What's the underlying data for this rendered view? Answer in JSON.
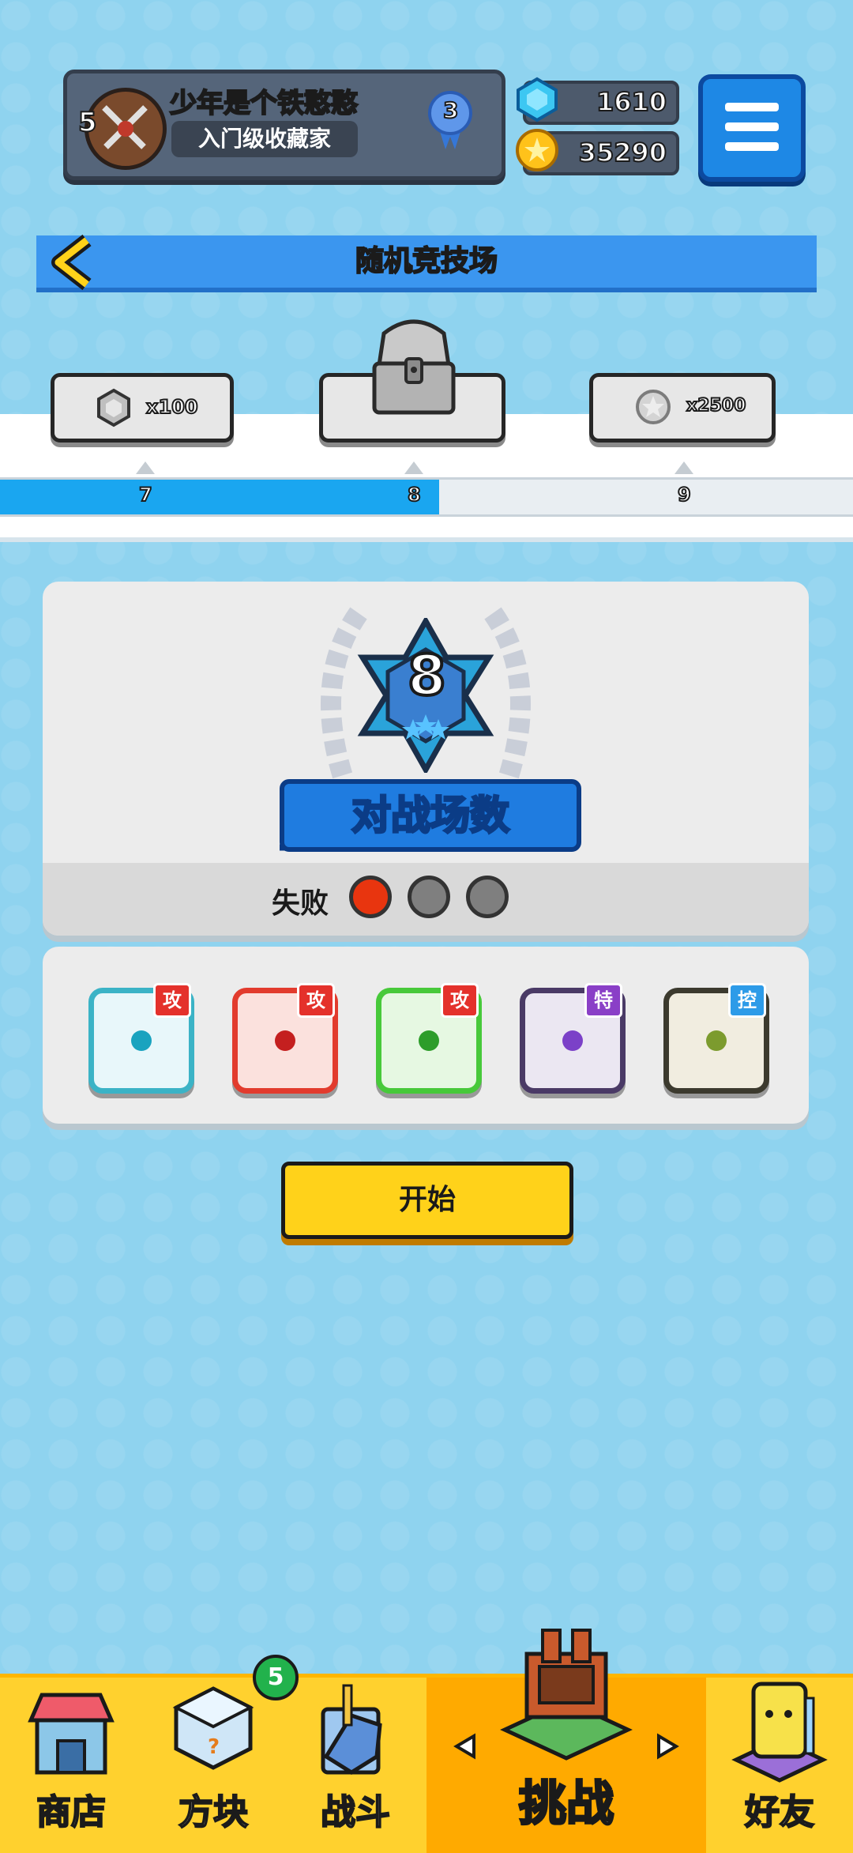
{
  "profile": {
    "name": "少年是个铁憨憨",
    "title": "入门级收藏家",
    "level": "5",
    "rank": "3"
  },
  "currency": {
    "gems": "1610",
    "gold": "35290"
  },
  "arena": {
    "title": "随机竞技场"
  },
  "rewards": {
    "items": [
      {
        "label": "x100",
        "icon": "hex-gem-icon"
      },
      {
        "label": "",
        "icon": "treasure-chest-icon"
      },
      {
        "label": "x2500",
        "icon": "silver-coin-icon"
      }
    ],
    "ticks": [
      "7",
      "8",
      "9"
    ],
    "progress": 0.515
  },
  "battle": {
    "count": "8",
    "label": "对战场数",
    "loss_label": "失败",
    "losses_used": 1,
    "losses_total": 3
  },
  "deck": [
    {
      "tag": "攻",
      "color": "#3bb3c6",
      "dot": "#19a3bf"
    },
    {
      "tag": "攻",
      "color": "#e23b2d",
      "dot": "#c41f1f"
    },
    {
      "tag": "攻",
      "color": "#47c93a",
      "dot": "#2d9d2a"
    },
    {
      "tag": "特",
      "color": "#6b4aa8",
      "dot": "#7b41c8"
    },
    {
      "tag": "控",
      "color": "#b79a3c",
      "dot": "#7c9b2e"
    }
  ],
  "start": {
    "label": "开始"
  },
  "nav": {
    "shop": "商店",
    "dice": "方块",
    "battle": "战斗",
    "challenge": "挑战",
    "friends": "好友",
    "dice_badge": "5"
  },
  "colors": {
    "accent_blue": "#1e88e5",
    "nav_yellow": "#ffd12e",
    "nav_active": "#ffaa00"
  }
}
